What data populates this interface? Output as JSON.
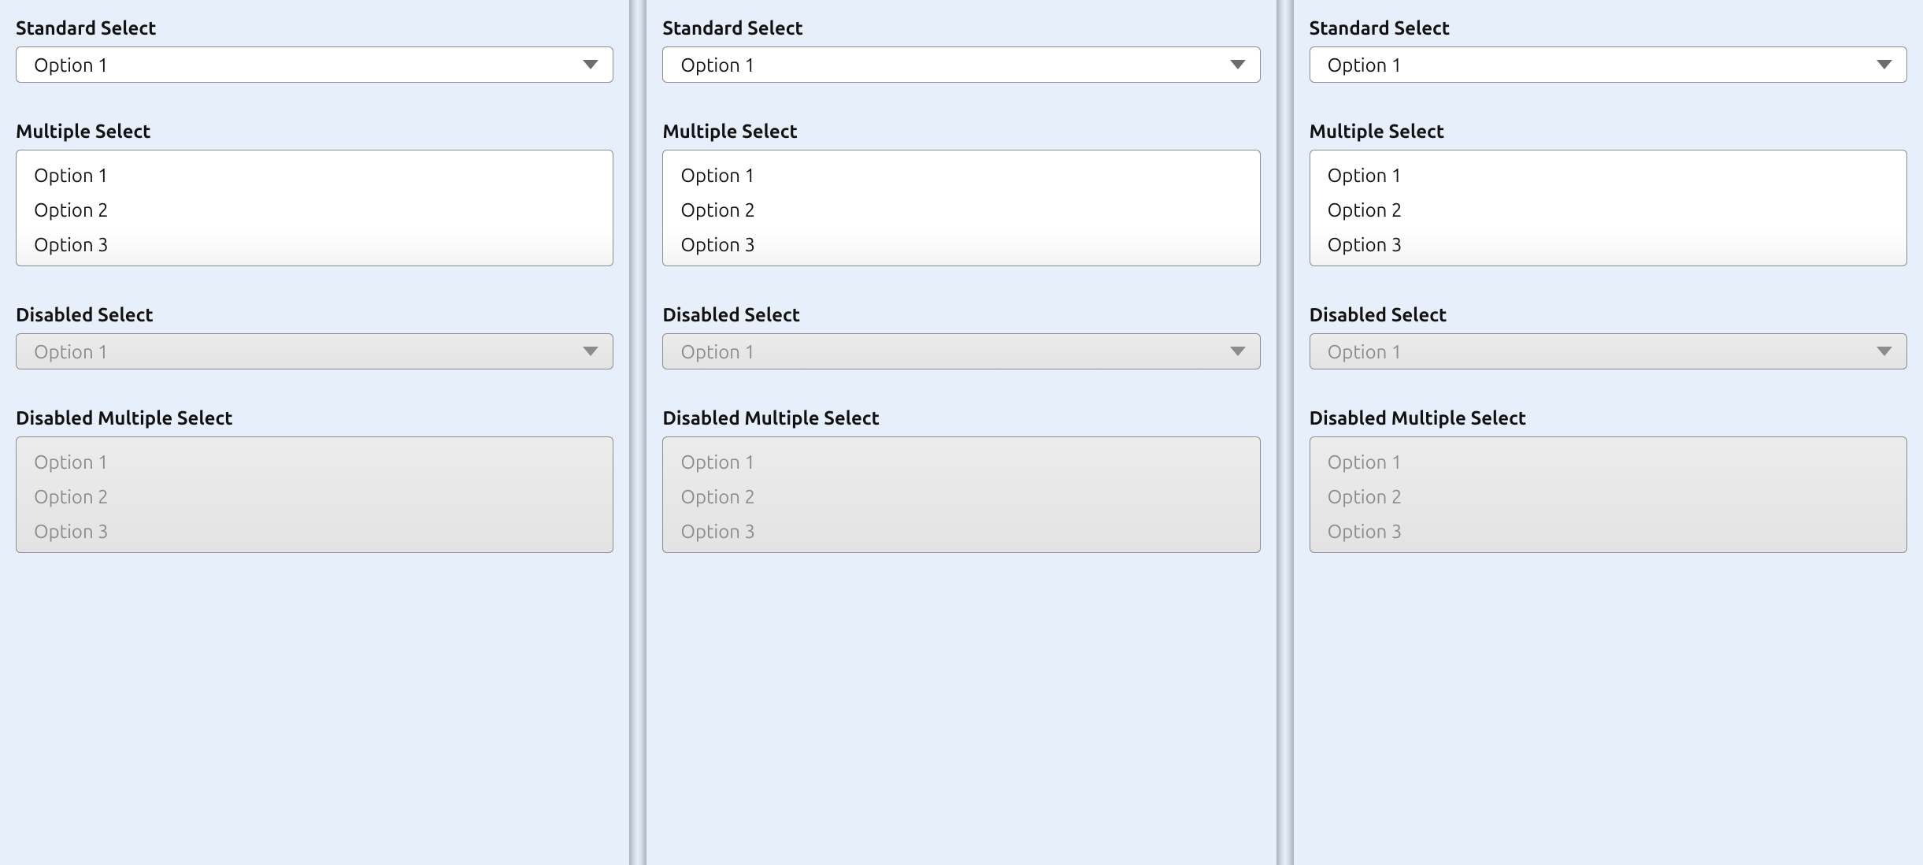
{
  "labels": {
    "standard": "Standard Select",
    "multiple": "Multiple Select",
    "disabled": "Disabled Select",
    "disabled_multiple": "Disabled Multiple Select"
  },
  "standard_value": "Option 1",
  "disabled_value": "Option 1",
  "options": {
    "o1": "Option 1",
    "o2": "Option 2",
    "o3": "Option 3"
  }
}
